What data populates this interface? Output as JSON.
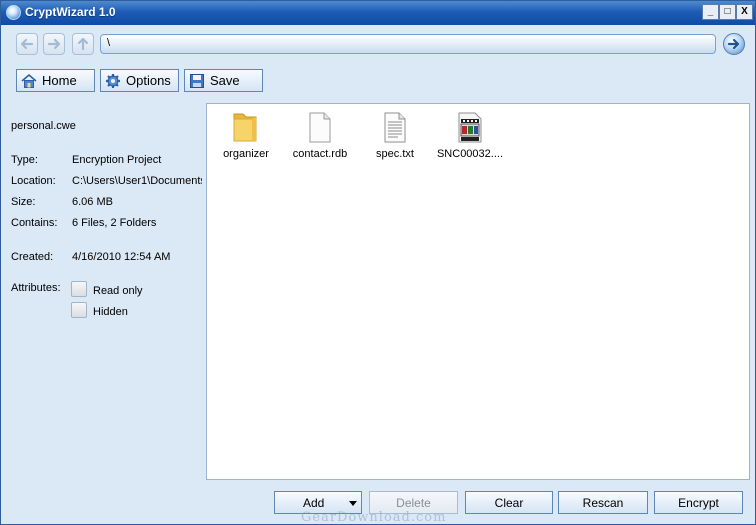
{
  "window": {
    "title": "CryptWizard 1.0",
    "controls": {
      "minimize": "_",
      "maximize": "□",
      "close": "X"
    }
  },
  "nav": {
    "path": "\\",
    "icons": {
      "back": "arrow-left-icon",
      "forward": "arrow-right-icon",
      "up": "arrow-up-icon",
      "go": "go-arrow-icon"
    }
  },
  "toolbar": {
    "home_label": "Home",
    "options_label": "Options",
    "save_label": "Save"
  },
  "info": {
    "filename": "personal.cwe",
    "type_label": "Type:",
    "type_value": "Encryption Project",
    "location_label": "Location:",
    "location_value": "C:\\Users\\User1\\Documents",
    "size_label": "Size:",
    "size_value": "6.06 MB",
    "contains_label": "Contains:",
    "contains_value": "6 Files, 2 Folders",
    "created_label": "Created:",
    "created_value": "4/16/2010 12:54 AM",
    "attributes_label": "Attributes:",
    "read_only_label": "Read only",
    "hidden_label": "Hidden"
  },
  "files": [
    {
      "name": "organizer",
      "icon": "folder-icon"
    },
    {
      "name": "contact.rdb",
      "icon": "file-icon"
    },
    {
      "name": "spec.txt",
      "icon": "text-file-icon"
    },
    {
      "name": "SNC00032....",
      "icon": "media-file-icon"
    }
  ],
  "actions": {
    "add_label": "Add",
    "delete_label": "Delete",
    "clear_label": "Clear",
    "rescan_label": "Rescan",
    "encrypt_label": "Encrypt"
  },
  "watermark": "GearDownload.com",
  "colors": {
    "titlebar": "#1d5db5",
    "panel": "#dbe8f5",
    "accent": "#4b87c7"
  }
}
